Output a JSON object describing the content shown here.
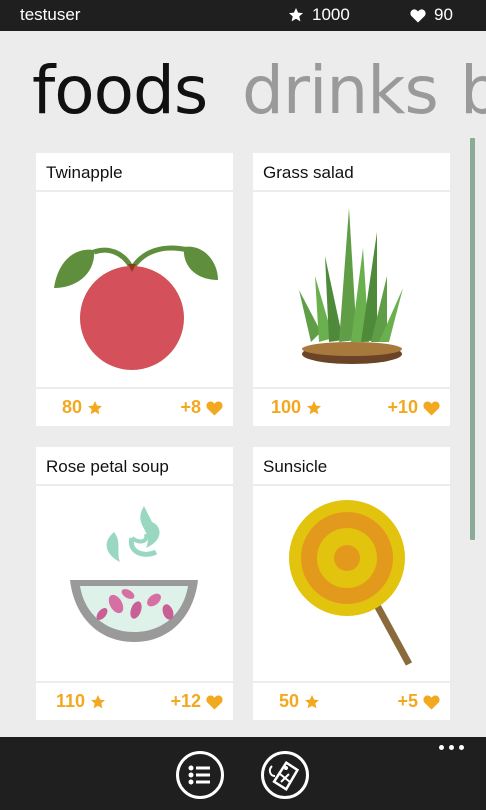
{
  "status": {
    "username": "testuser",
    "stars": "1000",
    "hearts": "90"
  },
  "pivot": {
    "tabs": [
      "foods",
      "drinks",
      "b"
    ],
    "active_index": 0
  },
  "items": [
    {
      "name": "Twinapple",
      "price": "80",
      "bonus": "+8",
      "icon": "twinapple-icon"
    },
    {
      "name": "Grass salad",
      "price": "100",
      "bonus": "+10",
      "icon": "grass-salad-icon"
    },
    {
      "name": "Rose petal soup",
      "price": "110",
      "bonus": "+12",
      "icon": "rose-petal-soup-icon"
    },
    {
      "name": "Sunsicle",
      "price": "50",
      "bonus": "+5",
      "icon": "sunsicle-icon"
    }
  ],
  "app_bar": {
    "buttons": [
      {
        "icon": "list-icon"
      },
      {
        "icon": "shop-tag-icon"
      }
    ],
    "more_icon": "ellipsis-icon"
  },
  "colors": {
    "accent": "#f2a81f",
    "status_bar": "#1f1f1f",
    "background": "#ececec",
    "scroll_indicator": "#8aab95"
  }
}
